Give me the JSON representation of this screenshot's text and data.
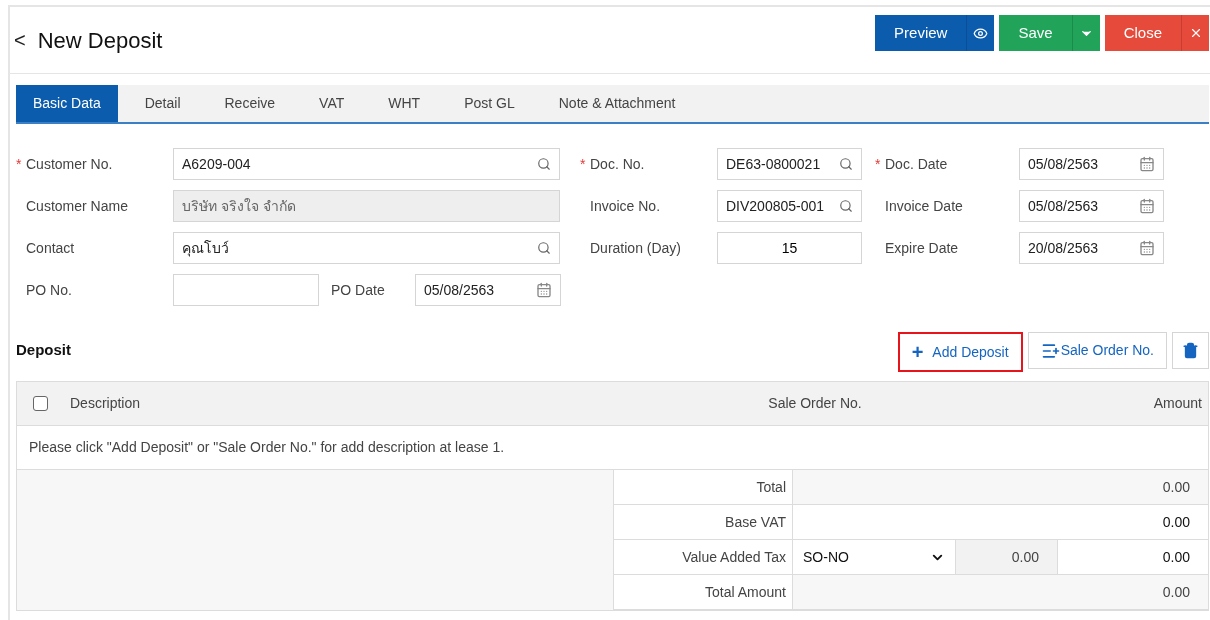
{
  "header": {
    "back": "<",
    "title": "New Deposit"
  },
  "actions": [
    {
      "label": "Preview",
      "kind": "preview"
    },
    {
      "label": "Save",
      "kind": "save"
    },
    {
      "label": "Close",
      "kind": "close"
    }
  ],
  "tabs": [
    {
      "label": "Basic Data",
      "selected": true
    },
    {
      "label": "Detail",
      "selected": false
    },
    {
      "label": "Receive",
      "selected": false
    },
    {
      "label": "VAT",
      "selected": false
    },
    {
      "label": "WHT",
      "selected": false
    },
    {
      "label": "Post GL",
      "selected": false
    },
    {
      "label": "Note & Attachment",
      "selected": false
    }
  ],
  "form": {
    "rows": [
      [
        {
          "required_mark": "*",
          "label": "Customer No.",
          "kind": "search",
          "value": "A6209-004"
        },
        {
          "required_mark": "*",
          "label": "Doc. No.",
          "kind": "search",
          "value": "DE63-0800021"
        },
        {
          "required_mark": "*",
          "label": "Doc. Date",
          "kind": "date",
          "value": "05/08/2563"
        }
      ],
      [
        {
          "label": "Customer Name",
          "kind": "readonly",
          "value": "บริษัท จริงใจ จำกัด"
        },
        {
          "label": "Invoice No.",
          "kind": "search",
          "value": "DIV200805-001"
        },
        {
          "label": "Invoice Date",
          "kind": "date",
          "value": "05/08/2563"
        }
      ],
      [
        {
          "label": "Contact",
          "kind": "search",
          "value": "คุณโบว์"
        },
        {
          "label": "Duration (Day)",
          "kind": "number",
          "value": "15"
        },
        {
          "label": "Expire Date",
          "kind": "date",
          "value": "20/08/2563"
        }
      ],
      [
        {
          "label": "PO No.",
          "kind": "text"
        },
        {
          "label": "PO Date",
          "kind": "date",
          "value": "05/08/2563"
        }
      ]
    ]
  },
  "deposit": {
    "title": "Deposit",
    "buttons": [
      {
        "label": "+",
        "text": "Add Deposit",
        "kind": "add",
        "highlighted": true
      },
      {
        "text": "Sale Order No.",
        "kind": "sale-order",
        "highlighted": false
      },
      {
        "kind": "delete",
        "highlighted": false
      }
    ],
    "table": {
      "select_all": {
        "checked": false
      },
      "columns": [
        "Description",
        "Sale Order No.",
        "Amount"
      ],
      "empty_message": "Please click \"Add Deposit\" or \"Sale Order No.\" for add description at lease 1."
    },
    "summary": [
      {
        "label": "Total",
        "kind": "readonly",
        "value": "0.00"
      },
      {
        "label": "Base VAT",
        "kind": "input",
        "value": "0.00"
      },
      {
        "label": "Value Added Tax",
        "kind": "vat",
        "select": "SO-NO",
        "rate": "0.00",
        "value": "0.00"
      },
      {
        "label": "Total Amount",
        "kind": "readonly",
        "value": "0.00"
      }
    ]
  }
}
